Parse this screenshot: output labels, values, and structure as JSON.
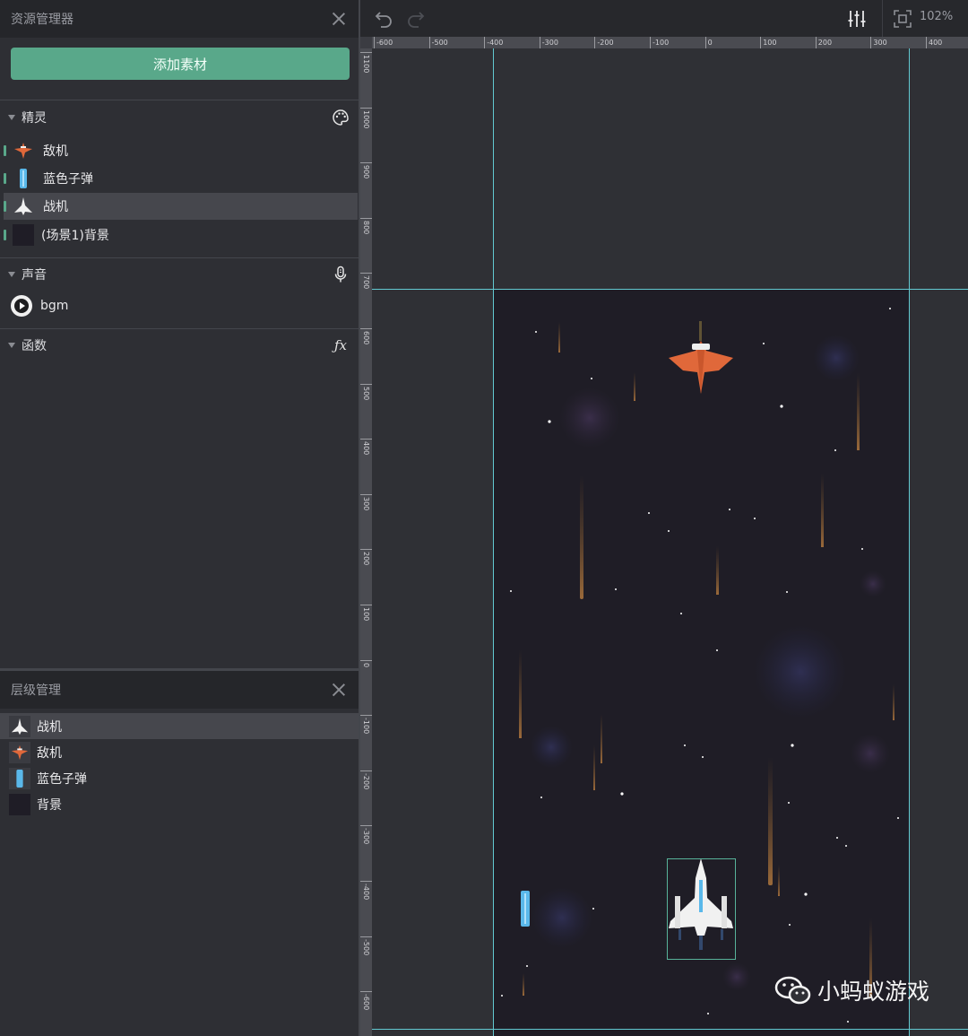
{
  "assets_panel": {
    "title": "资源管理器",
    "add_button": "添加素材",
    "sprites_section": "精灵",
    "sprites": [
      "敌机",
      "蓝色子弹",
      "战机",
      "(场景1)背景"
    ],
    "sound_section": "声音",
    "sounds": [
      "bgm"
    ],
    "functions_section": "函数"
  },
  "layers_panel": {
    "title": "层级管理",
    "layers": [
      "战机",
      "敌机",
      "蓝色子弹",
      "背景"
    ]
  },
  "toolbar": {
    "zoom": "102%"
  },
  "ruler": {
    "h_ticks": [
      "-600",
      "-500",
      "-400",
      "-300",
      "-200",
      "-100",
      "0",
      "100",
      "200",
      "300",
      "400"
    ],
    "v_ticks": [
      "1100",
      "1000",
      "900",
      "800",
      "700",
      "600",
      "500",
      "400",
      "300",
      "200",
      "100",
      "0",
      "-100",
      "-200",
      "-300",
      "-400",
      "-500",
      "-600"
    ]
  },
  "watermark": "小蚂蚁游戏",
  "colors": {
    "accent_green": "#59a88a",
    "guide_cyan": "#62c9d1",
    "stage_bg": "#1f1d26",
    "enemy_orange": "#e0683a",
    "bullet_blue": "#5ab8ea"
  },
  "icons": {
    "assets_close": "close-icon",
    "palette": "palette-icon",
    "microphone": "microphone-icon",
    "function": "function-icon",
    "undo": "undo-icon",
    "redo": "redo-icon",
    "adjust": "sliders-icon",
    "fit": "fit-screen-icon"
  }
}
